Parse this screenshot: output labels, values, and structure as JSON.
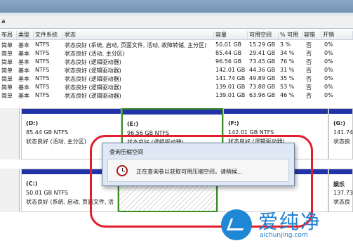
{
  "top_menu_glyph": "a",
  "columns": [
    "布局",
    "类型",
    "文件系统",
    "状态",
    "容量",
    "可用空间",
    "% 可用",
    "容错",
    "开销"
  ],
  "rows": [
    [
      "简单",
      "基本",
      "NTFS",
      "状态良好 (系统, 启动, 页面文件, 活动, 故障转储, 主分区)",
      "50.01 GB",
      "15.29 GB",
      "3 %",
      "否",
      "0%"
    ],
    [
      "简单",
      "基本",
      "NTFS",
      "状态良好 (活动, 主分区)",
      "85.44 GB",
      "29.41 GB",
      "34 %",
      "否",
      "0%"
    ],
    [
      "简单",
      "基本",
      "NTFS",
      "状态良好 (逻辑驱动器)",
      "96.56 GB",
      "73.45 GB",
      "76 %",
      "否",
      "0%"
    ],
    [
      "简单",
      "基本",
      "NTFS",
      "状态良好 (逻辑驱动器)",
      "142.01 GB",
      "44.36 GB",
      "31 %",
      "否",
      "0%"
    ],
    [
      "简单",
      "基本",
      "NTFS",
      "状态良好 (逻辑驱动器)",
      "141.74 GB",
      "49.89 GB",
      "35 %",
      "否",
      "0%"
    ],
    [
      "简单",
      "基本",
      "NTFS",
      "状态良好 (逻辑驱动器)",
      "139.01 GB",
      "73.88 GB",
      "53 %",
      "否",
      "0%"
    ],
    [
      "简单",
      "基本",
      "NTFS",
      "状态良好 (逻辑驱动器)",
      "139.01 GB",
      "63.96 GB",
      "46 %",
      "否",
      "0%"
    ]
  ],
  "partitions_top": [
    {
      "name": "(D:)",
      "size": "85.44 GB NTFS",
      "status": "状态良好 (活动, 主分区)"
    },
    {
      "name": "(E:)",
      "size": "96.56 GB NTFS",
      "status": "状态良好 (逻辑驱动器)"
    },
    {
      "name": "(F:)",
      "size": "142.01 GB NTFS",
      "status": "状态良好 (逻辑驱动器)"
    },
    {
      "name": "(G:)",
      "size": "141.74",
      "status": "状态良"
    }
  ],
  "partitions_bottom": [
    {
      "name": "(C:)",
      "size": "50.01 GB NTFS",
      "status": "状态良好 (系统, 启动, 页面文件, 活"
    },
    {
      "name": "",
      "size": "",
      "status": ""
    },
    {
      "name": "",
      "size": "",
      "status": ""
    },
    {
      "name": "娱乐",
      "size": "137.73",
      "status": "状态良"
    }
  ],
  "dialog": {
    "title": "查询压缩空间",
    "message": "正在查询卷以获取可用压缩空间，请稍候..."
  },
  "watermark": {
    "brand": "爱纯净",
    "domain": "aichunjing.com"
  },
  "colors": {
    "partition_bar": "#2233a8",
    "selected_border": "#3b8d2a",
    "highlight_ring": "#e21d2c"
  }
}
